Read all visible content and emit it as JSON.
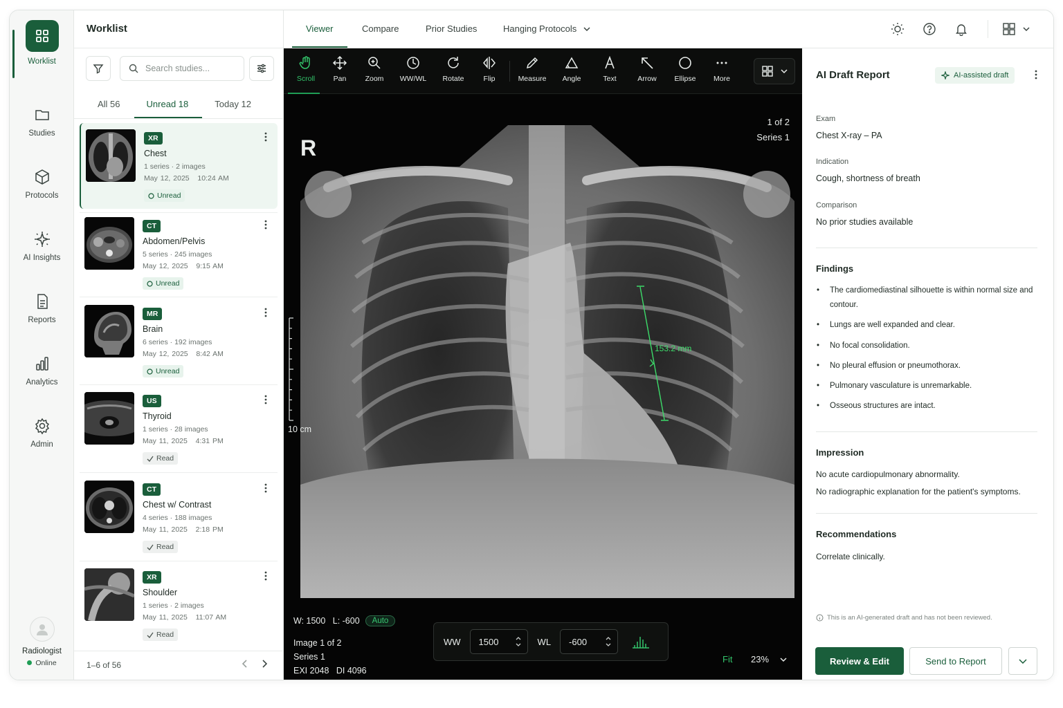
{
  "rail": {
    "items": [
      {
        "label": "Worklist",
        "icon": "grid-icon"
      },
      {
        "label": "Studies",
        "icon": "folder-icon"
      },
      {
        "label": "Protocols",
        "icon": "cube-icon"
      },
      {
        "label": "AI Insights",
        "icon": "sparkle-icon"
      },
      {
        "label": "Reports",
        "icon": "document-icon"
      },
      {
        "label": "Analytics",
        "icon": "bar-chart-icon"
      },
      {
        "label": "Admin",
        "icon": "gear-icon"
      }
    ],
    "user": {
      "role": "Radiologist",
      "status": "Online"
    }
  },
  "worklist": {
    "title": "Worklist",
    "search_placeholder": "Search studies...",
    "tabs": [
      {
        "label": "All 56"
      },
      {
        "label": "Unread 18"
      },
      {
        "label": "Today 12"
      }
    ],
    "studies": [
      {
        "modality": "XR",
        "name": "Chest",
        "meta": "1 series · 2 images",
        "date": "May 12, 2025   10:24 AM",
        "status": "Unread"
      },
      {
        "modality": "CT",
        "name": "Abdomen/Pelvis",
        "meta": "5 series · 245 images",
        "date": "May 12, 2025   9:15 AM",
        "status": "Unread"
      },
      {
        "modality": "MR",
        "name": "Brain",
        "meta": "6 series · 192 images",
        "date": "May 12, 2025   8:42 AM",
        "status": "Unread"
      },
      {
        "modality": "US",
        "name": "Thyroid",
        "meta": "1 series · 28 images",
        "date": "May 11, 2025   4:31 PM",
        "status": "Read"
      },
      {
        "modality": "CT",
        "name": "Chest w/ Contrast",
        "meta": "4 series · 188 images",
        "date": "May 11, 2025   2:18 PM",
        "status": "Read"
      },
      {
        "modality": "XR",
        "name": "Shoulder",
        "meta": "1 series · 2 images",
        "date": "May 11, 2025   11:07 AM",
        "status": "Read"
      }
    ],
    "pagination": "1–6 of 56"
  },
  "topnav": {
    "tabs": [
      "Viewer",
      "Compare",
      "Prior Studies",
      "Hanging Protocols"
    ]
  },
  "toolbar": {
    "tools": [
      "Scroll",
      "Pan",
      "Zoom",
      "WW/WL",
      "Rotate",
      "Flip",
      "Measure",
      "Angle",
      "Text",
      "Arrow",
      "Ellipse",
      "More"
    ]
  },
  "viewer": {
    "orientation": "R",
    "image_count": "1 of 2",
    "series": "Series 1",
    "scale": "10 cm",
    "measurement": "153.2 mm",
    "window": "W: 1500   L: -600",
    "auto": "Auto",
    "image_info": [
      "Image 1 of 2",
      "Series 1",
      "EXI 2048   DI 4096"
    ],
    "ww_label": "WW",
    "ww_value": "1500",
    "wl_label": "WL",
    "wl_value": "-600",
    "fit": "Fit",
    "zoom": "23%"
  },
  "report": {
    "title": "AI Draft Report",
    "badge": "AI-assisted draft",
    "exam_label": "Exam",
    "exam": "Chest X-ray – PA",
    "indication_label": "Indication",
    "indication": "Cough, shortness of breath",
    "comparison_label": "Comparison",
    "comparison": "No prior studies available",
    "findings_title": "Findings",
    "findings": [
      "The cardiomediastinal silhouette is within normal size and contour.",
      "Lungs are well expanded and clear.",
      "No focal consolidation.",
      "No pleural effusion or pneumothorax.",
      "Pulmonary vasculature is unremarkable.",
      "Osseous structures are intact."
    ],
    "impression_title": "Impression",
    "impression": [
      "No acute cardiopulmonary abnormality.",
      "No radiographic explanation for the patient's symptoms."
    ],
    "recommendations_title": "Recommendations",
    "recommendations": "Correlate clinically.",
    "disclaimer": "This is an AI-generated draft and has not been reviewed.",
    "primary_action": "Review & Edit",
    "secondary_action": "Send to Report"
  },
  "colors": {
    "brand": "#1a5e3b",
    "accent": "#33c46b",
    "viewer_bg": "#050505",
    "measure": "#3ddc6a"
  }
}
